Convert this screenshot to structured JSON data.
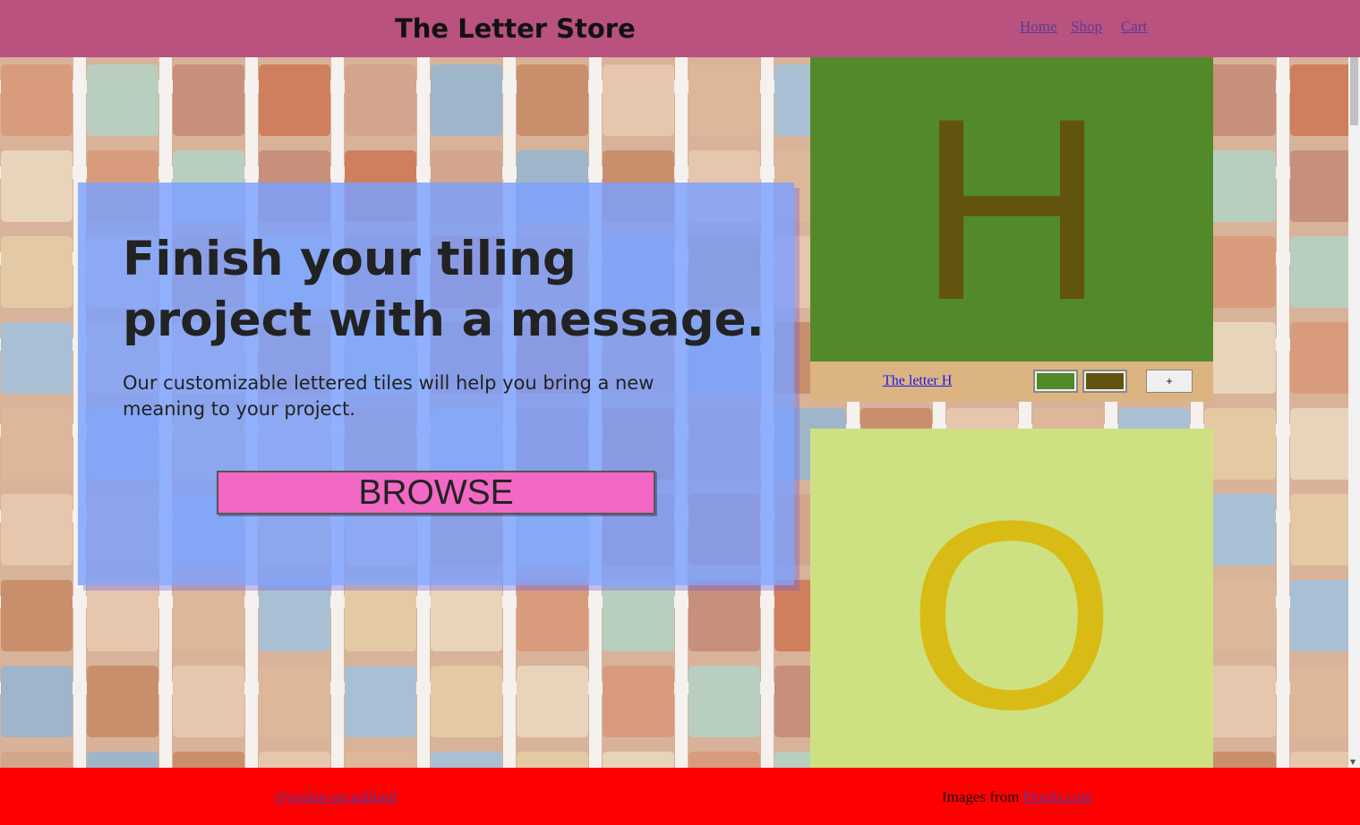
{
  "header": {
    "title": "The Letter Store",
    "nav": [
      "Home",
      "Shop",
      "Cart"
    ]
  },
  "hero": {
    "headline": "Finish your tiling project with a message.",
    "subtext": "Our customizable lettered tiles will help you bring a new meaning to your project.",
    "button_label": "BROWSE"
  },
  "products": [
    {
      "letter": "H",
      "link_label": "The letter H",
      "background_color": "#528a2a",
      "letter_color": "#62540f",
      "add_label": "+"
    },
    {
      "letter": "O",
      "background_color": "#cee182",
      "letter_color": "#d8bb14"
    }
  ],
  "footer": {
    "credit": "@jordan-mcgalliard",
    "images_prefix": "Images from",
    "images_link": "Pexels.com"
  },
  "colors": {
    "header_bg": "#b9527f",
    "footer_bg": "#ff0000",
    "hero_card": "#7aa0ff",
    "browse_button": "#f268c4"
  }
}
